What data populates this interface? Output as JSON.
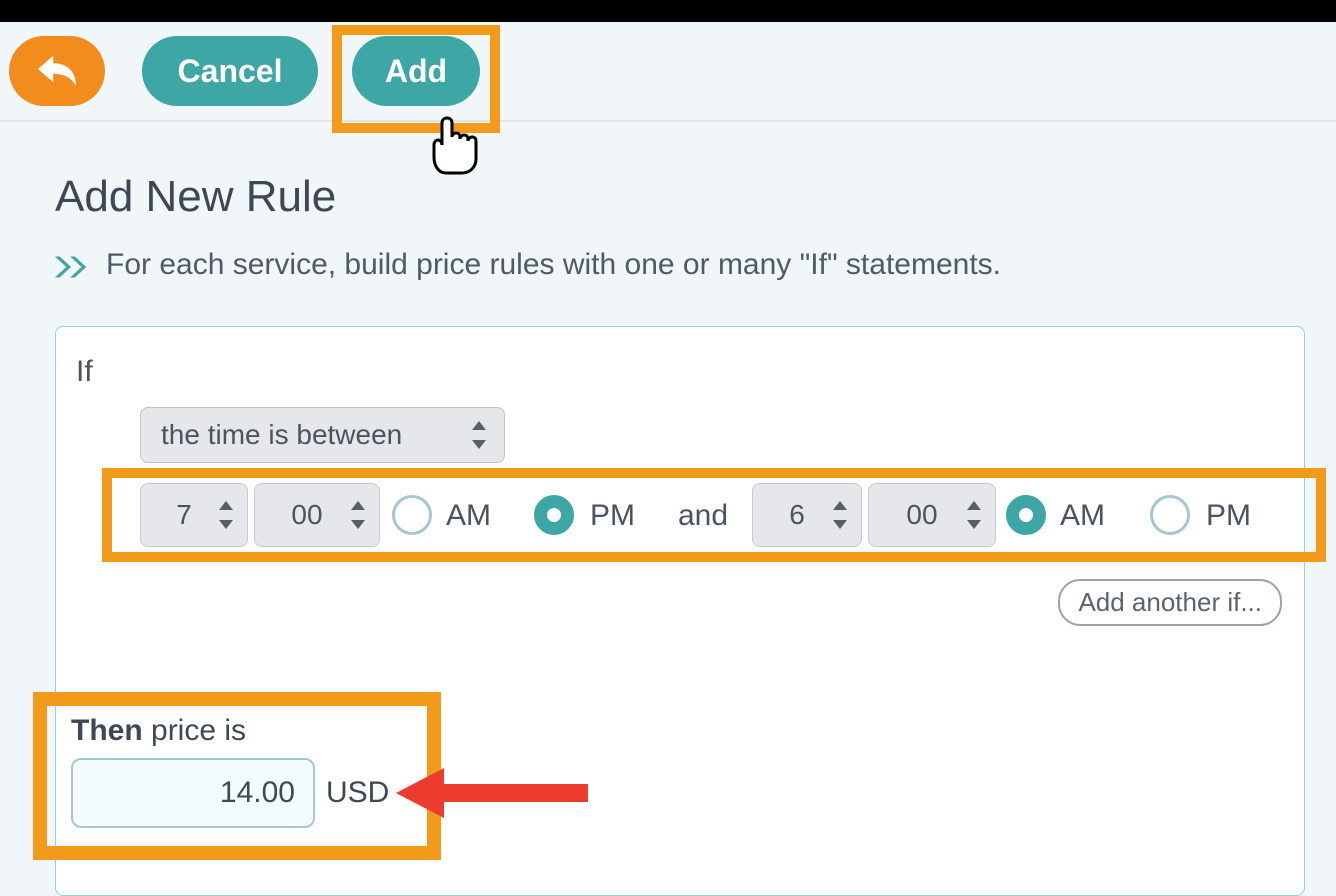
{
  "toolbar": {
    "cancel_label": "Cancel",
    "add_label": "Add"
  },
  "page": {
    "title": "Add New Rule",
    "subtitle": "For each service, build price rules with one or many \"If\" statements."
  },
  "condition": {
    "if_label": "If",
    "selector_label": "the time is between",
    "start": {
      "hour": "7",
      "minute": "00",
      "am": "AM",
      "pm": "PM",
      "selected": "PM"
    },
    "and_label": "and",
    "end": {
      "hour": "6",
      "minute": "00",
      "am": "AM",
      "pm": "PM",
      "selected": "AM"
    },
    "add_another_label": "Add another if..."
  },
  "then": {
    "prefix_bold": "Then",
    "prefix_rest": " price is",
    "price": "14.00",
    "currency": "USD"
  }
}
